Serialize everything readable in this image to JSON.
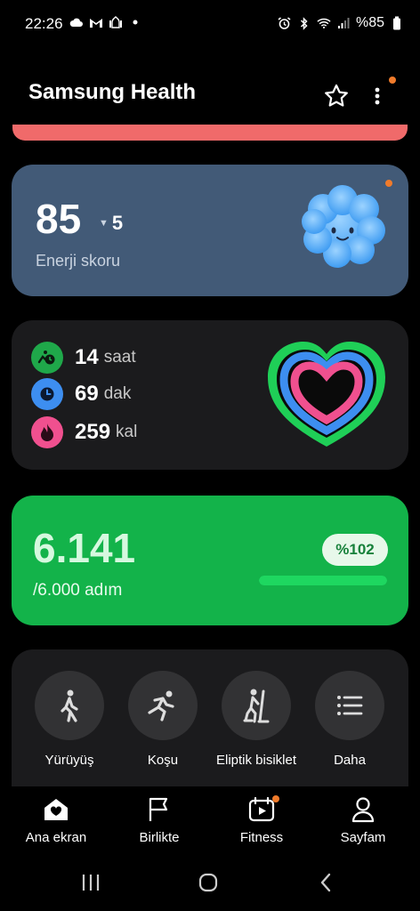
{
  "status_bar": {
    "time": "22:26",
    "battery": "%85",
    "left_icons": [
      "cloud-icon",
      "gmail-icon",
      "mosque-icon",
      "dot-icon"
    ],
    "right_icons": [
      "alarm-icon",
      "bluetooth-icon",
      "wifi-icon",
      "signal-icon",
      "battery-icon"
    ]
  },
  "header": {
    "title": "Samsung Health",
    "star_icon": "star-outline-icon",
    "more_icon": "more-vertical-icon"
  },
  "energy": {
    "score": "85",
    "change": "5",
    "change_direction": "down",
    "label": "Enerji skoru"
  },
  "activity": {
    "rows": [
      {
        "value": "14",
        "unit": "saat",
        "icon": "activity-time-icon",
        "color": "#1fa84a"
      },
      {
        "value": "69",
        "unit": "dak",
        "icon": "clock-icon",
        "color": "#3d8ef0"
      },
      {
        "value": "259",
        "unit": "kal",
        "icon": "flame-icon",
        "color": "#f0508f"
      }
    ]
  },
  "steps": {
    "count": "6.141",
    "target": "/6.000 adım",
    "percent_label": "%102",
    "progress": 1.0
  },
  "shortcuts": [
    {
      "label": "Yürüyüş",
      "icon": "walking-icon"
    },
    {
      "label": "Koşu",
      "icon": "running-icon"
    },
    {
      "label": "Eliptik bisiklet",
      "icon": "elliptical-icon"
    },
    {
      "label": "Daha",
      "icon": "list-icon"
    }
  ],
  "bottom_nav": [
    {
      "label": "Ana ekran",
      "icon": "home-heart-icon",
      "active": true
    },
    {
      "label": "Birlikte",
      "icon": "flag-icon",
      "active": false
    },
    {
      "label": "Fitness",
      "icon": "fitness-play-icon",
      "active": false
    },
    {
      "label": "Sayfam",
      "icon": "person-icon",
      "active": false
    }
  ],
  "colors": {
    "energy_card": "#425a77",
    "steps_card": "#13b34a",
    "notification_dot": "#f07b2b",
    "strip": "#f06a6a"
  }
}
